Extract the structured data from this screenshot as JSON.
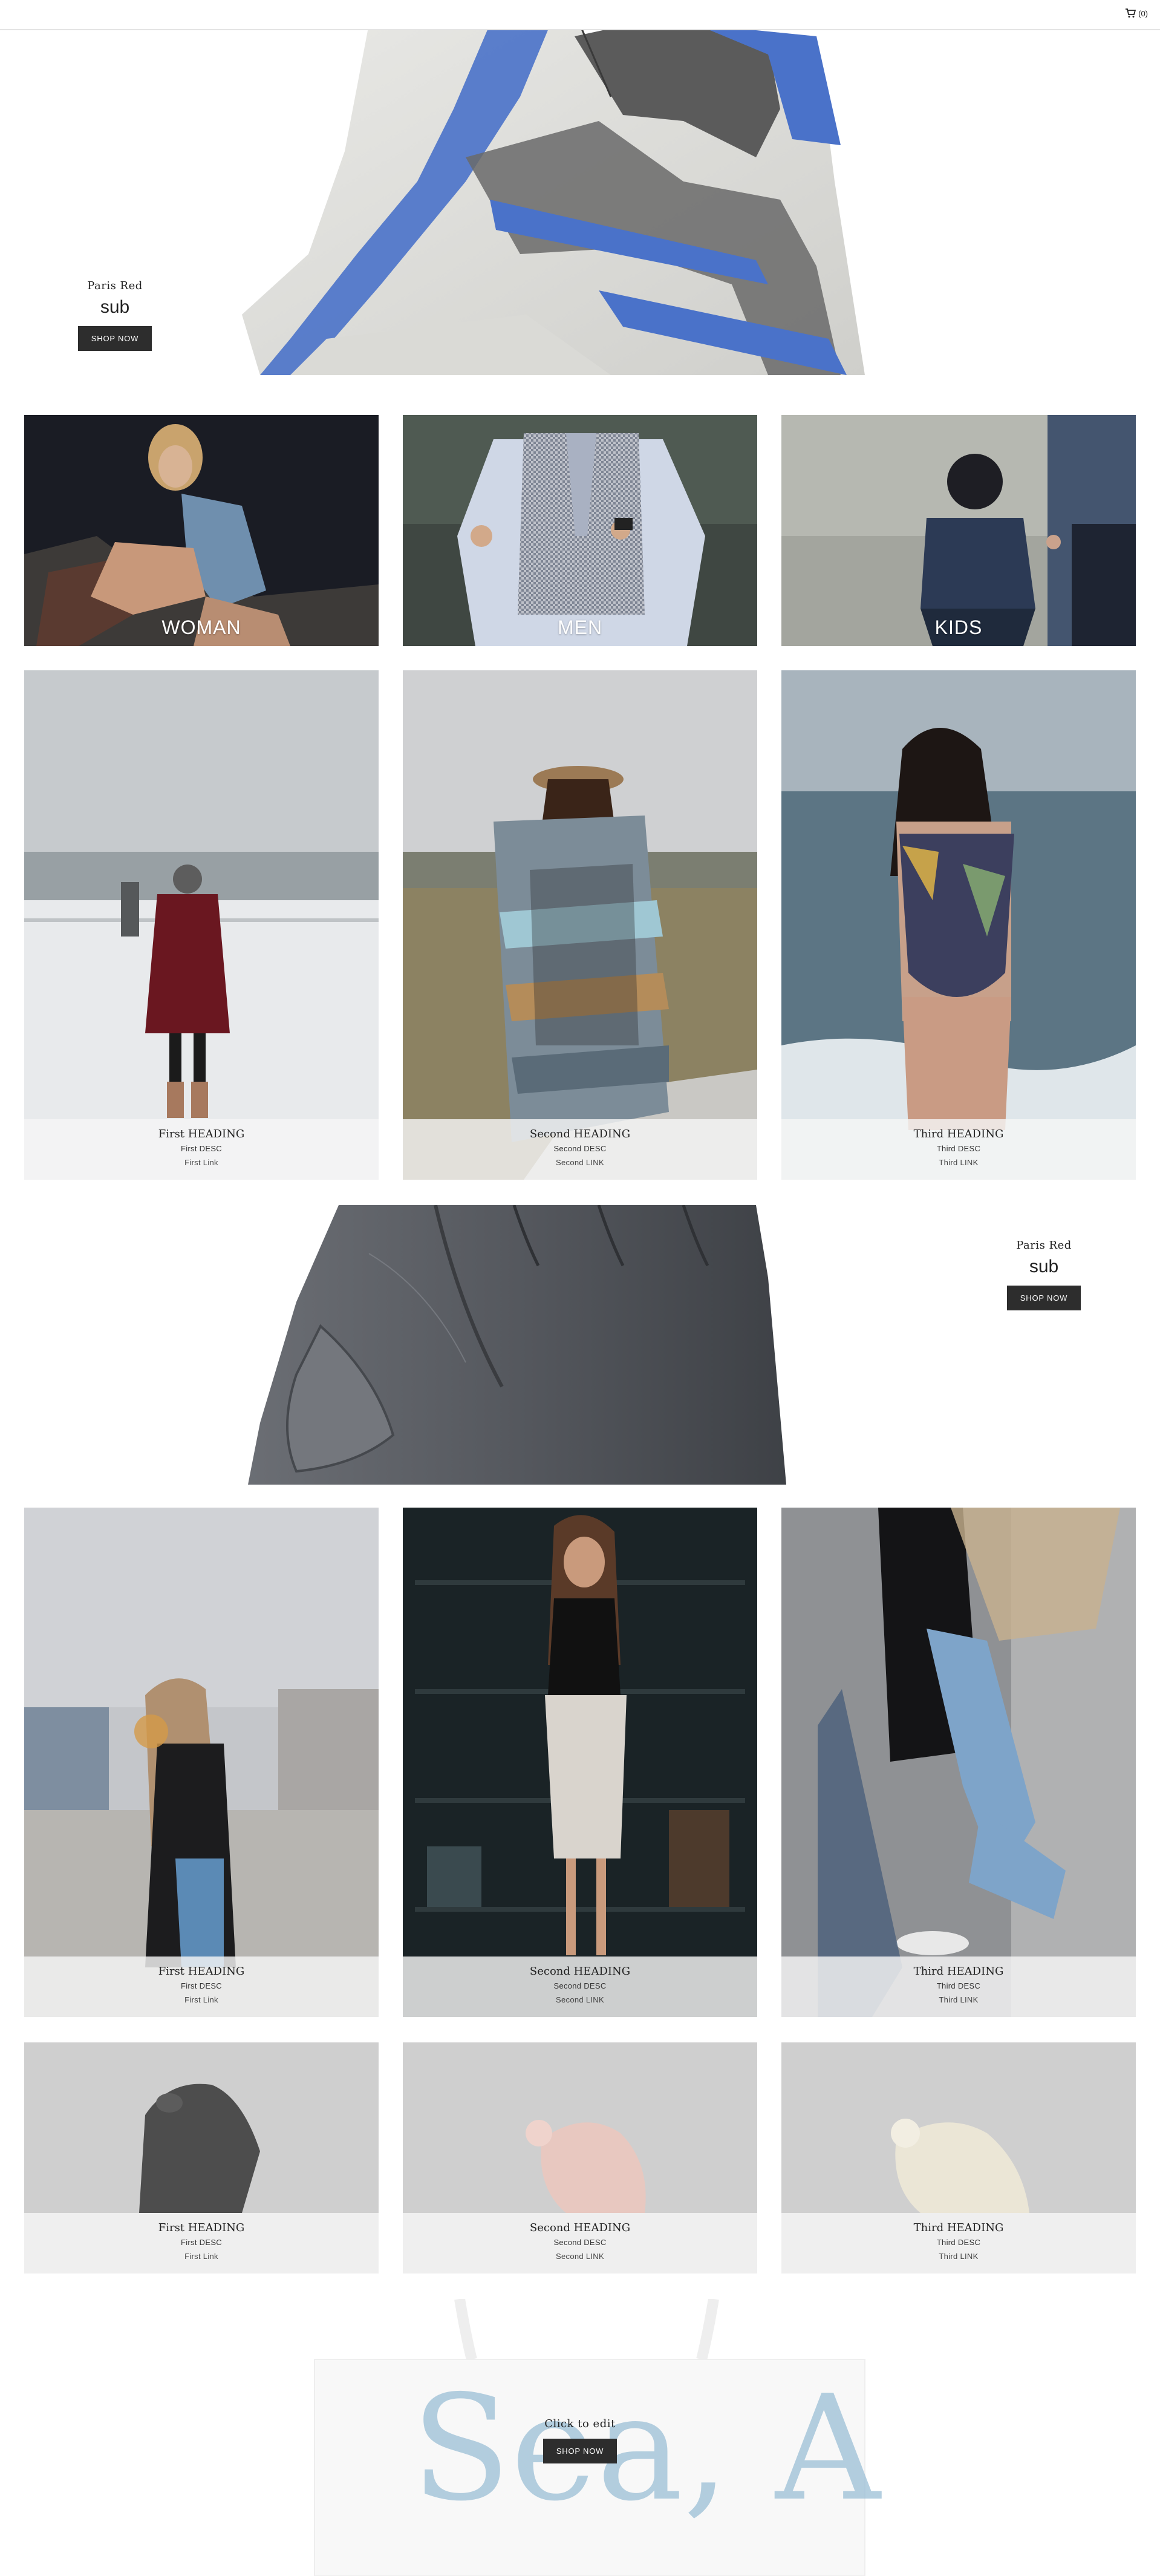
{
  "topbar": {
    "cart_label": "(0)",
    "cart_icon": "cart-icon"
  },
  "hero1": {
    "brand": "Paris Red",
    "sub": "sub",
    "button": "SHOP NOW"
  },
  "categories": [
    {
      "label": "WOMAN"
    },
    {
      "label": "MEN"
    },
    {
      "label": "KIDS"
    }
  ],
  "products_row1": [
    {
      "heading": "First HEADING",
      "desc": "First DESC",
      "link": "First Link"
    },
    {
      "heading": "Second HEADING",
      "desc": "Second DESC",
      "link": "Second LINK"
    },
    {
      "heading": "Third HEADING",
      "desc": "Third DESC",
      "link": "Third LINK"
    }
  ],
  "hero2": {
    "brand": "Paris Red",
    "sub": "sub",
    "button": "SHOP NOW"
  },
  "products_row2": [
    {
      "heading": "First HEADING",
      "desc": "First DESC",
      "link": "First Link"
    },
    {
      "heading": "Second HEADING",
      "desc": "Second DESC",
      "link": "Second LINK"
    },
    {
      "heading": "Third HEADING",
      "desc": "Third DESC",
      "link": "Third LINK"
    }
  ],
  "products_row3": [
    {
      "heading": "First HEADING",
      "desc": "First DESC",
      "link": "First Link"
    },
    {
      "heading": "Second HEADING",
      "desc": "Second DESC",
      "link": "Second LINK"
    },
    {
      "heading": "Third HEADING",
      "desc": "Third DESC",
      "link": "Third LINK"
    }
  ],
  "hero3": {
    "title": "Click to edit",
    "button": "SHOP NOW",
    "bag_print": "Sea, Air"
  },
  "colors": {
    "button_bg": "#2d2d2d",
    "scarf_blue": "#4a72c9",
    "bag_print": "#9bbfd6"
  }
}
